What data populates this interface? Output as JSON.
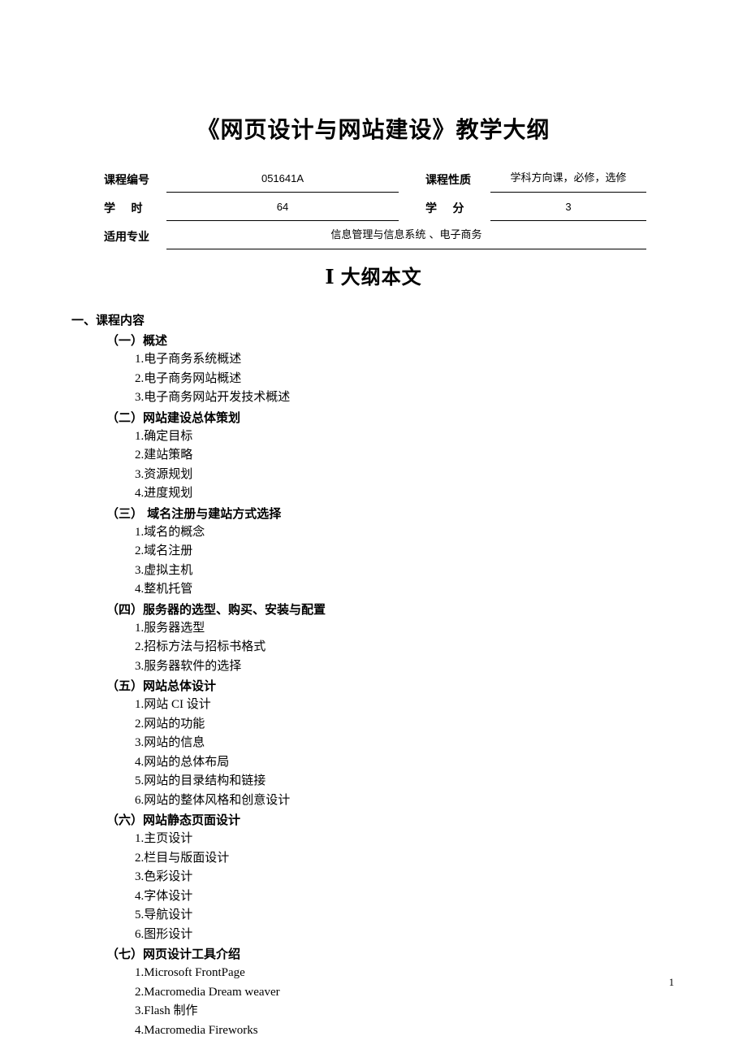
{
  "document": {
    "title": "《网页设计与网站建设》教学大纲",
    "page_number": "1"
  },
  "meta": {
    "course_code_label": "课程编号",
    "course_code_value": "051641A",
    "course_nature_label": "课程性质",
    "course_nature_value": "学科方向课，必修，选修",
    "hours_label": "学    时",
    "hours_value": "64",
    "credits_label": "学    分",
    "credits_value": "3",
    "majors_label": "适用专业",
    "majors_value": "信息管理与信息系统 、电子商务"
  },
  "part_heading": "Ⅰ  大纲本文",
  "outline": {
    "section_title": "一、课程内容",
    "groups": [
      {
        "heading": "（一）概述",
        "items": [
          "1.电子商务系统概述",
          "2.电子商务网站概述",
          "3.电子商务网站开发技术概述"
        ]
      },
      {
        "heading": "（二）网站建设总体策划",
        "items": [
          "1.确定目标",
          "2.建站策略",
          "3.资源规划",
          "4.进度规划"
        ]
      },
      {
        "heading": "（三） 域名注册与建站方式选择",
        "items": [
          "1.域名的概念",
          "2.域名注册",
          "3.虚拟主机",
          "4.整机托管"
        ]
      },
      {
        "heading": "（四）服务器的选型、购买、安装与配置",
        "items": [
          "1.服务器选型",
          "2.招标方法与招标书格式",
          "3.服务器软件的选择"
        ]
      },
      {
        "heading": "（五）网站总体设计",
        "items": [
          "1.网站 CI 设计",
          "2.网站的功能",
          "3.网站的信息",
          "4.网站的总体布局",
          "5.网站的目录结构和链接",
          "6.网站的整体风格和创意设计"
        ]
      },
      {
        "heading": "（六）网站静态页面设计",
        "items": [
          "1.主页设计",
          "2.栏目与版面设计",
          "3.色彩设计",
          "4.字体设计",
          "5.导航设计",
          "6.图形设计"
        ]
      },
      {
        "heading": "（七）网页设计工具介绍",
        "items": [
          "1.Microsoft FrontPage",
          "2.Macromedia Dream weaver",
          "3.Flash 制作",
          "4.Macromedia Fireworks"
        ]
      }
    ]
  }
}
